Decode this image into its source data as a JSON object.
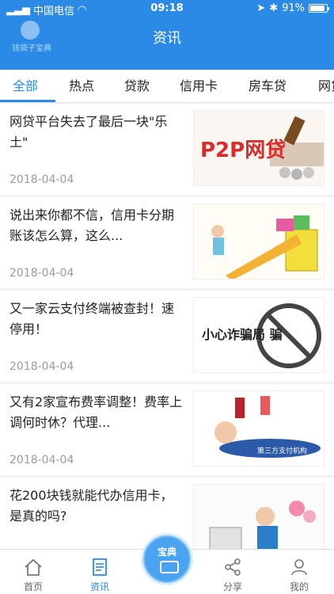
{
  "status_bar": {
    "carrier": "中国电信",
    "time": "09:18",
    "battery": "91%"
  },
  "header": {
    "title": "资讯",
    "logo_text": "钱袋子宝典"
  },
  "tabs": [
    {
      "label": "全部",
      "active": true
    },
    {
      "label": "热点",
      "active": false
    },
    {
      "label": "贷款",
      "active": false
    },
    {
      "label": "信用卡",
      "active": false
    },
    {
      "label": "房车贷",
      "active": false
    },
    {
      "label": "网贷",
      "active": false
    }
  ],
  "articles": [
    {
      "title": "网贷平台失去了最后一块\"乐土\"",
      "date": "2018-04-04",
      "image_text": "P2P网贷"
    },
    {
      "title": "说出来你都不信，信用卡分期账该怎么算，这么...",
      "date": "2018-04-04",
      "image_text": ""
    },
    {
      "title": "又一家云支付终端被查封！速停用！",
      "date": "2018-04-04",
      "image_text": "小心诈骗局 骗"
    },
    {
      "title": "又有2家宣布费率调整！费率上调何时休？代理...",
      "date": "2018-04-04",
      "image_text": "第三方支付机构"
    },
    {
      "title": "花200块钱就能代办信用卡，是真的吗?",
      "date": "",
      "image_text": ""
    }
  ],
  "bottom_nav": [
    {
      "label": "首页",
      "icon": "home-icon",
      "active": false
    },
    {
      "label": "资讯",
      "icon": "news-icon",
      "active": true
    },
    {
      "label": "宝典",
      "icon": "center-icon",
      "active": false
    },
    {
      "label": "分享",
      "icon": "share-icon",
      "active": false
    },
    {
      "label": "我的",
      "icon": "profile-icon",
      "active": false
    }
  ],
  "colors": {
    "primary": "#2b8ae6",
    "background": "#f2f2f2"
  }
}
